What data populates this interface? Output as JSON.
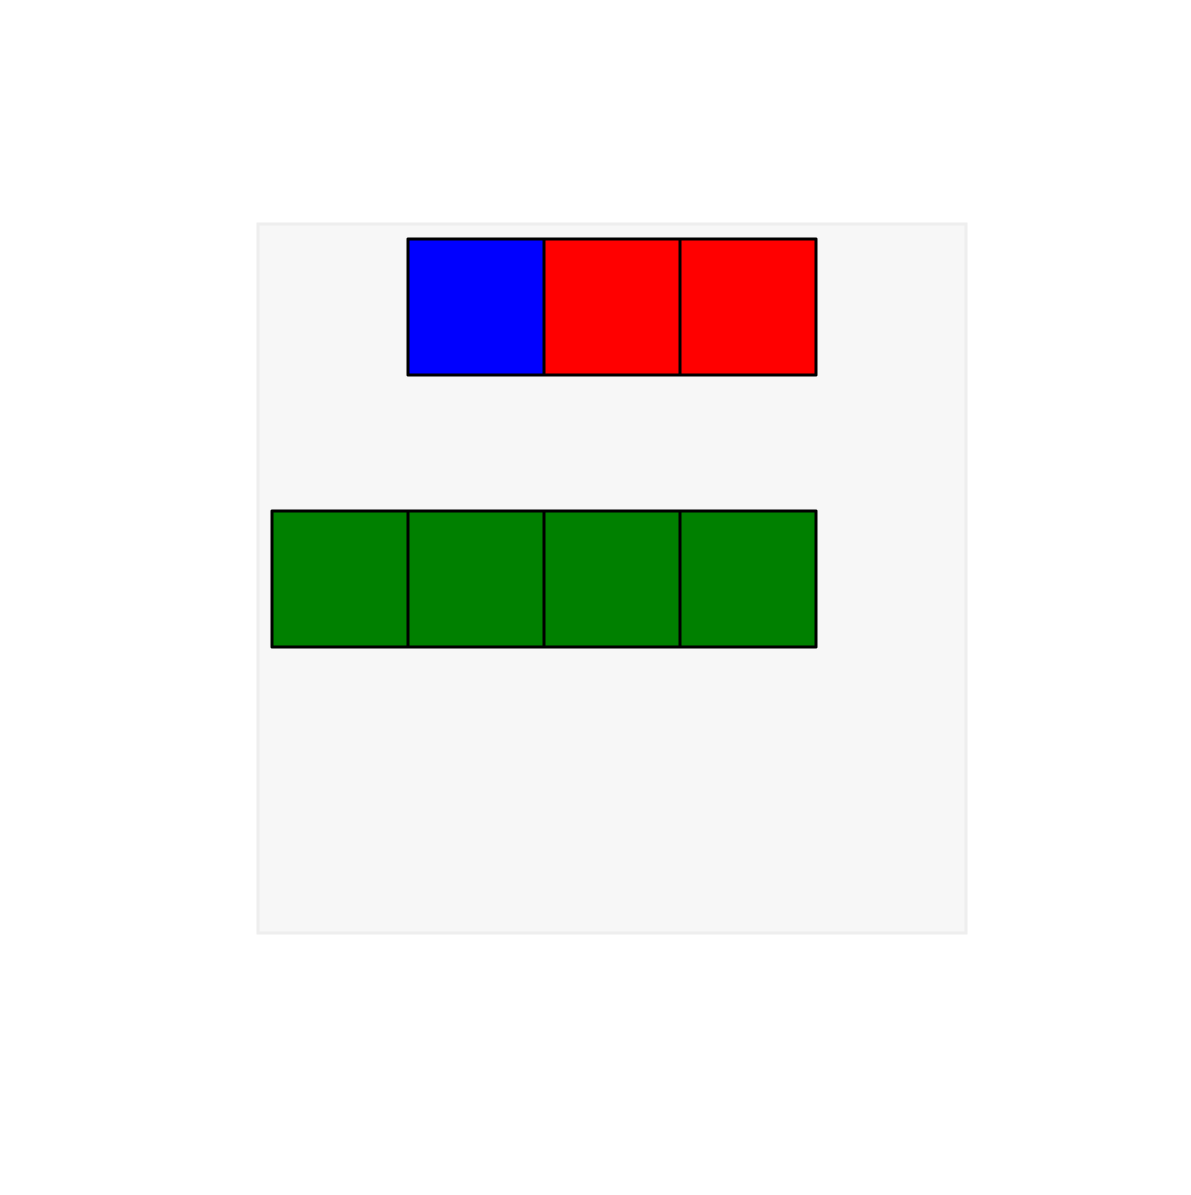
{
  "board": {
    "background_color": "#f7f7f7",
    "border_color": "#eeeeee"
  },
  "rows": [
    {
      "name": "top-row",
      "cells": [
        {
          "color": "#0000ff",
          "color_name": "blue"
        },
        {
          "color": "#ff0000",
          "color_name": "red"
        },
        {
          "color": "#ff0000",
          "color_name": "red"
        }
      ]
    },
    {
      "name": "bottom-row",
      "cells": [
        {
          "color": "#008000",
          "color_name": "green"
        },
        {
          "color": "#008000",
          "color_name": "green"
        },
        {
          "color": "#008000",
          "color_name": "green"
        },
        {
          "color": "#008000",
          "color_name": "green"
        }
      ]
    }
  ],
  "cell_outline_color": "#000000"
}
